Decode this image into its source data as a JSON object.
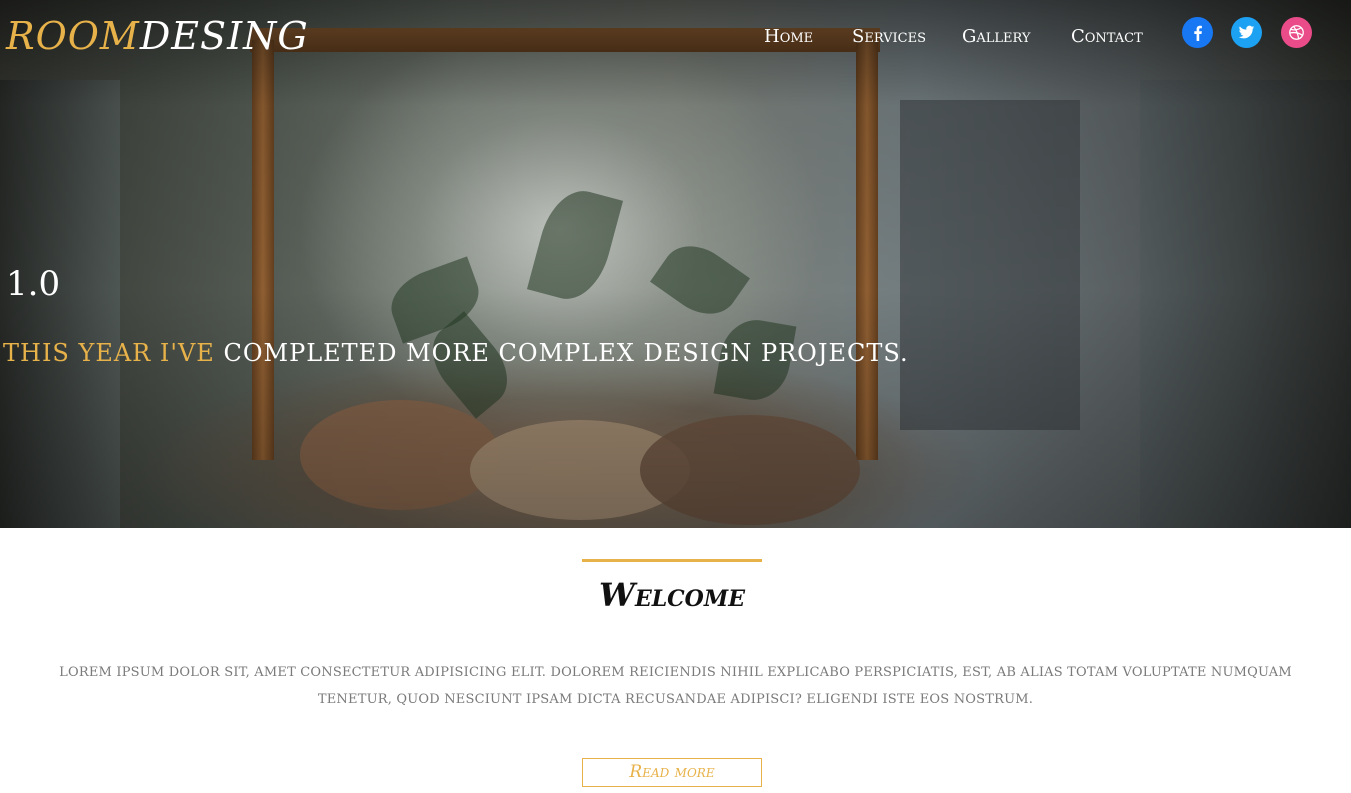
{
  "brand": {
    "part1": "ROOM",
    "part2": "DESING"
  },
  "nav": {
    "items": [
      {
        "label": "Home"
      },
      {
        "label": "Services"
      },
      {
        "label": "Gallery"
      },
      {
        "label": "Contact"
      }
    ]
  },
  "social": {
    "icons": [
      "facebook-icon",
      "twitter-icon",
      "dribbble-icon"
    ],
    "colors": {
      "facebook": "#1877f2",
      "twitter": "#1da1f2",
      "dribbble": "#ea4c89"
    }
  },
  "hero": {
    "number": "1.0",
    "subtitle_gold": "THIS YEAR I'VE",
    "subtitle_white": "COMPLETED MORE COMPLEX DESIGN PROJECTS."
  },
  "welcome": {
    "title": "Welcome",
    "text": "Lorem ipsum dolor sit, amet consectetur adipisicing elit. Dolorem reiciendis nihil explicabo perspiciatis, est, ab alias totam voluptate numquam tenetur, quod nesciunt ipsam dicta recusandae adipisci? Eligendi iste eos nostrum.",
    "button": "Read more"
  },
  "colors": {
    "accent": "#e8b24a",
    "text_muted": "#7a7a7a"
  }
}
